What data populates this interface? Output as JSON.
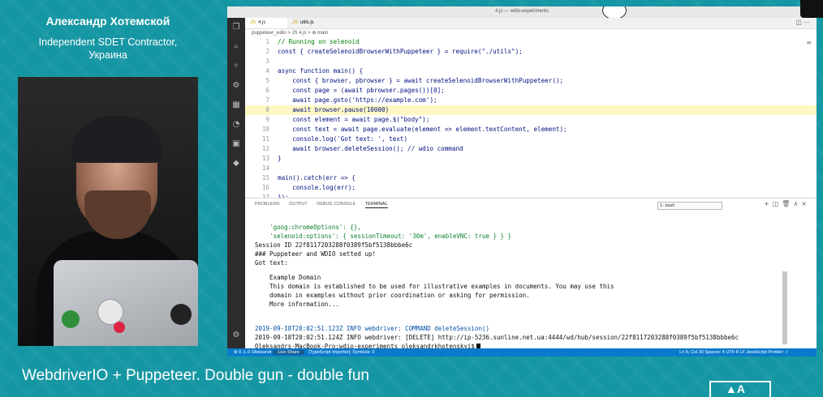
{
  "speaker": {
    "name": "Александр Хотемской",
    "role_line1": "Independent SDET Contractor,",
    "role_line2": "Украина"
  },
  "talk_title": "WebdriverIO + Puppeteer. Double gun - double fun",
  "window": {
    "title": "4.js — wdio-experiments"
  },
  "editor": {
    "tabs": [
      {
        "label": "4.js",
        "active": true
      },
      {
        "label": "utils.js",
        "active": false
      }
    ],
    "breadcrumb": "puppeteer_wdio  >  JS 4.js  >  ⊕ main",
    "lines": [
      {
        "n": "1",
        "text": "// Running on selenoid",
        "kind": "comment"
      },
      {
        "n": "2",
        "text": "const { createSelenoidBrowserWithPuppeteer } = require(\"./utils\");",
        "kind": "code"
      },
      {
        "n": "3",
        "text": "",
        "kind": "code"
      },
      {
        "n": "4",
        "text": "async function main() {",
        "kind": "code"
      },
      {
        "n": "5",
        "text": "    const { browser, pbrowser } = await createSelenoidBrowserWithPuppeteer();",
        "kind": "code"
      },
      {
        "n": "6",
        "text": "    const page = (await pbrowser.pages())[0];",
        "kind": "code"
      },
      {
        "n": "7",
        "text": "    await page.goto('https://example.com');",
        "kind": "code"
      },
      {
        "n": "8",
        "text": "    await browser.pause(10000)",
        "kind": "highlight"
      },
      {
        "n": "9",
        "text": "    const element = await page.$(\"body\");",
        "kind": "code"
      },
      {
        "n": "10",
        "text": "    const text = await page.evaluate(element => element.textContent, element);",
        "kind": "code"
      },
      {
        "n": "11",
        "text": "    console.log('Got text: ', text)",
        "kind": "code"
      },
      {
        "n": "12",
        "text": "    await browser.deleteSession(); // wdio command",
        "kind": "code"
      },
      {
        "n": "13",
        "text": "}",
        "kind": "code"
      },
      {
        "n": "14",
        "text": "",
        "kind": "code"
      },
      {
        "n": "15",
        "text": "main().catch(err => {",
        "kind": "code"
      },
      {
        "n": "16",
        "text": "    console.log(err);",
        "kind": "code"
      },
      {
        "n": "17",
        "text": "});",
        "kind": "code"
      }
    ]
  },
  "panel": {
    "tabs": [
      "PROBLEMS",
      "OUTPUT",
      "DEBUG CONSOLE",
      "TERMINAL"
    ],
    "active_tab": "TERMINAL",
    "terminal_select": "1: bash",
    "terminal": {
      "l1": "    'goog:chromeOptions': {},",
      "l2": "    'selenoid:options': { sessionTimeout: '30m', enableVNC: true } } }",
      "l3": "Session ID 22f8117203288f0389f5bf5138bbbe6c",
      "l4": "### Puppeteer and WDIO setted up!",
      "l5": "Got text:",
      "l6": "    Example Domain",
      "l7": "    This domain is established to be used for illustrative examples in documents. You may use this",
      "l8": "    domain in examples without prior coordination or asking for permission.",
      "l9": "    More information...",
      "l10": "2019-09-18T20:02:51.123Z INFO webdriver: COMMAND deleteSession()",
      "l11": "2019-09-18T20:02:51.124Z INFO webdriver: [DELETE] http://ip-5236.sunline.net.ua:4444/wd/hub/session/22f8117203288f0389f5bf5138bbbe6c",
      "l12": "Oleksandrs-MacBook-Pro:wdio-experiments oleksandrkhotenskyi$"
    }
  },
  "statusbar": {
    "left": "⊗ 0 ⚠ 0   Oleksandr",
    "live_share": "Live Share",
    "import": "[TypeScript Importer]: Symbols: 0",
    "right": "Ln 8, Col 30   Spaces: 4   UTF-8   LF   JavaScript   Prettier: ✓"
  },
  "colors": {
    "background": "#1596a3",
    "status_bar": "#0a7acc"
  }
}
